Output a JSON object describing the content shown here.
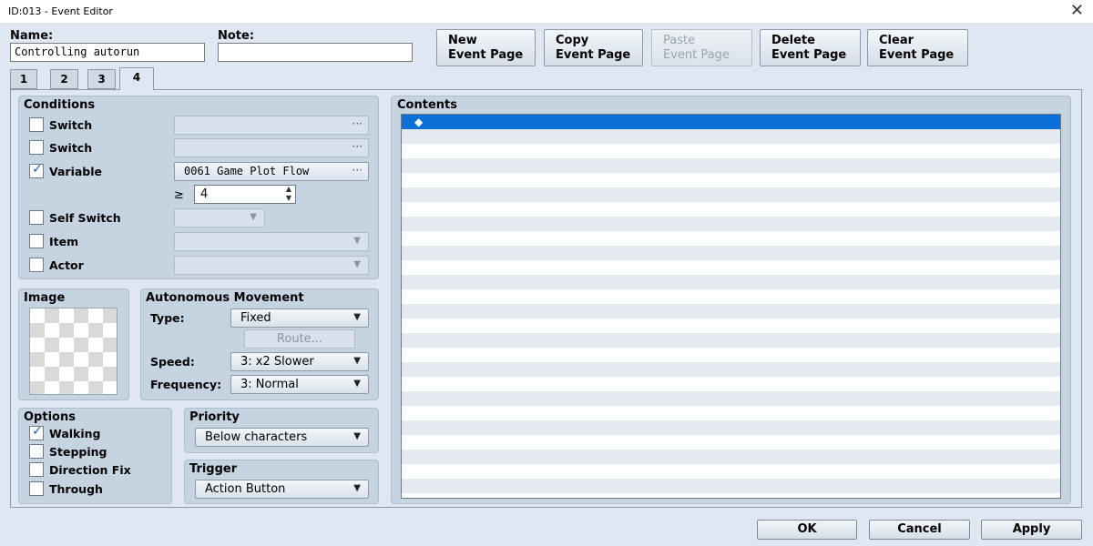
{
  "window": {
    "title": "ID:013 - Event Editor",
    "close_icon": "close-icon"
  },
  "header": {
    "name_label": "Name:",
    "name_value": "Controlling autorun",
    "note_label": "Note:",
    "note_value": "",
    "buttons": {
      "new": [
        "New",
        "Event Page"
      ],
      "copy": [
        "Copy",
        "Event Page"
      ],
      "paste": [
        "Paste",
        "Event Page"
      ],
      "delete": [
        "Delete",
        "Event Page"
      ],
      "clear": [
        "Clear",
        "Event Page"
      ]
    }
  },
  "tabs": [
    "1",
    "2",
    "3",
    "4"
  ],
  "active_tab": "4",
  "conditions": {
    "title": "Conditions",
    "switch1_label": "Switch",
    "switch2_label": "Switch",
    "variable_label": "Variable",
    "variable_value": "0061 Game Plot Flow",
    "variable_checked": true,
    "compare_symbol": "≥",
    "compare_value": "4",
    "self_switch_label": "Self Switch",
    "item_label": "Item",
    "actor_label": "Actor",
    "dots": "···"
  },
  "image": {
    "title": "Image"
  },
  "movement": {
    "title": "Autonomous Movement",
    "type_label": "Type:",
    "type_value": "Fixed",
    "route_label": "Route...",
    "speed_label": "Speed:",
    "speed_value": "3: x2 Slower",
    "frequency_label": "Frequency:",
    "frequency_value": "3: Normal"
  },
  "options": {
    "title": "Options",
    "walking_label": "Walking",
    "walking_checked": true,
    "stepping_label": "Stepping",
    "direction_fix_label": "Direction Fix",
    "through_label": "Through"
  },
  "priority": {
    "title": "Priority",
    "value": "Below characters"
  },
  "trigger": {
    "title": "Trigger",
    "value": "Action Button"
  },
  "contents": {
    "title": "Contents",
    "first_row_marker": "◆"
  },
  "footer": {
    "ok": "OK",
    "cancel": "Cancel",
    "apply": "Apply"
  },
  "colors": {
    "selection": "#0a6fd6",
    "row_alt": "#e4eaf0",
    "panel": "#c6d4e2",
    "background": "#dfe8f2"
  }
}
